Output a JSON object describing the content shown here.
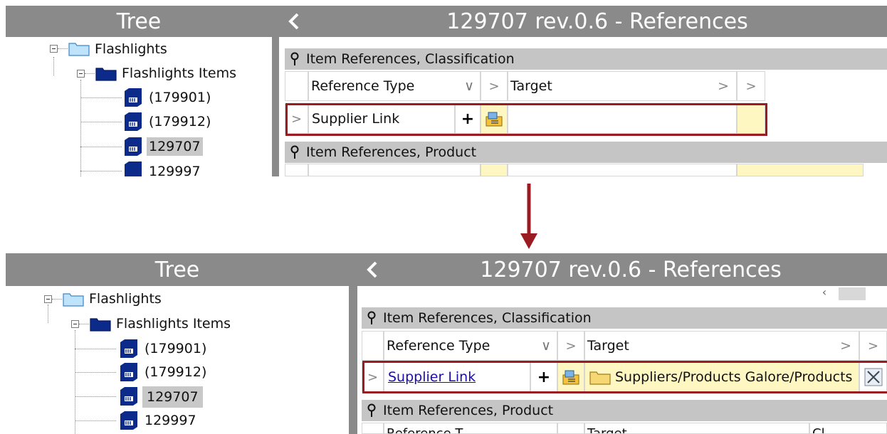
{
  "top": {
    "tree_header": "Tree",
    "ref_header": "129707 rev.0.6 - References",
    "tree": {
      "root": "Flashlights",
      "child": "Flashlights Items",
      "items": [
        "(179901)",
        "(179912)",
        "129707",
        "129997"
      ]
    },
    "section_classification": "Item References, Classification",
    "section_product": "Item References, Product",
    "columns": {
      "reference_type": "Reference Type",
      "target": "Target"
    },
    "row": {
      "reference_type": "Supplier Link",
      "plus": "+",
      "target": ""
    }
  },
  "bottom": {
    "tree_header": "Tree",
    "ref_header": "129707 rev.0.6 - References",
    "tree": {
      "root": "Flashlights",
      "child": "Flashlights Items",
      "items": [
        "(179901)",
        "(179912)",
        "129707",
        "129997"
      ]
    },
    "section_classification": "Item References, Classification",
    "section_product": "Item References, Product",
    "columns": {
      "reference_type": "Reference Type",
      "target": "Target"
    },
    "row": {
      "reference_type": "Supplier Link",
      "plus": "+",
      "target": "Suppliers/Products Galore/Products"
    },
    "partial_row": {
      "col1": "Reference T",
      "col2": "Target",
      "col3": "Cl"
    }
  },
  "colors": {
    "header": "#8a8a8a",
    "section": "#c5c5c5",
    "highlight_box": "#9b1b23",
    "arrow": "#9b1b23",
    "selected": "#c8c8c8",
    "link": "#1a0dab"
  },
  "icons": [
    "folder-light-icon",
    "folder-dark-icon",
    "item-icon",
    "back-arrow-icon",
    "pin-icon",
    "target-select-icon",
    "folder-target-icon",
    "clear-icon",
    "down-arrow-icon"
  ]
}
